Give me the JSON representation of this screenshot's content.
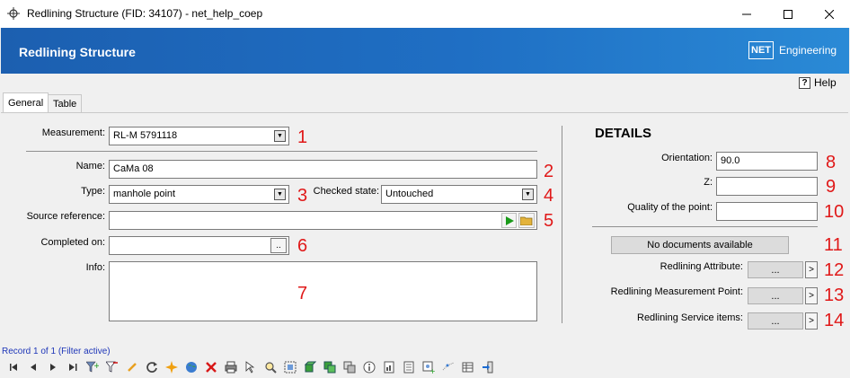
{
  "window": {
    "title": "Redlining Structure (FID: 34107) - net_help_coep",
    "minimize": "—",
    "maximize": "☐",
    "close": "✕"
  },
  "header": {
    "title": "Redlining Structure",
    "logo_box": "NET",
    "logo_text": "Engineering"
  },
  "help": {
    "icon_glyph": "?",
    "label": "Help"
  },
  "tabs": [
    {
      "label": "General",
      "active": true
    },
    {
      "label": "Table",
      "active": false
    }
  ],
  "form": {
    "measurement": {
      "label": "Measurement:",
      "value": "RL-M 5791118",
      "marker": "1"
    },
    "name": {
      "label": "Name:",
      "value": "CaMa 08",
      "marker": "2"
    },
    "type": {
      "label": "Type:",
      "value": "manhole point",
      "marker": "3"
    },
    "checked_state": {
      "label": "Checked state:",
      "value": "Untouched",
      "marker": "4"
    },
    "source_reference": {
      "label": "Source reference:",
      "value": "",
      "marker": "5"
    },
    "completed_on": {
      "label": "Completed on:",
      "value": "",
      "button": "..",
      "marker": "6"
    },
    "info": {
      "label": "Info:",
      "value": "",
      "marker": "7"
    }
  },
  "details": {
    "heading": "DETAILS",
    "orientation": {
      "label": "Orientation:",
      "value": "90.0",
      "marker": "8"
    },
    "z": {
      "label": "Z:",
      "value": "",
      "marker": "9"
    },
    "quality": {
      "label": "Quality of the point:",
      "value": "",
      "marker": "10"
    },
    "documents": {
      "label": "No documents available",
      "marker": "11"
    },
    "links": [
      {
        "label": "Redlining Attribute:",
        "button": "...",
        "arrow": ">",
        "marker": "12"
      },
      {
        "label": "Redlining Measurement Point:",
        "button": "...",
        "arrow": ">",
        "marker": "13"
      },
      {
        "label": "Redlining Service items:",
        "button": "...",
        "arrow": ">",
        "marker": "14"
      }
    ]
  },
  "footer": {
    "record_text": "Record 1 of 1 (Filter active)"
  },
  "colors": {
    "banner_start": "#1c5fb0",
    "banner_end": "#2a8ad6",
    "marker": "#e01818",
    "record_text": "#1e36b8"
  }
}
